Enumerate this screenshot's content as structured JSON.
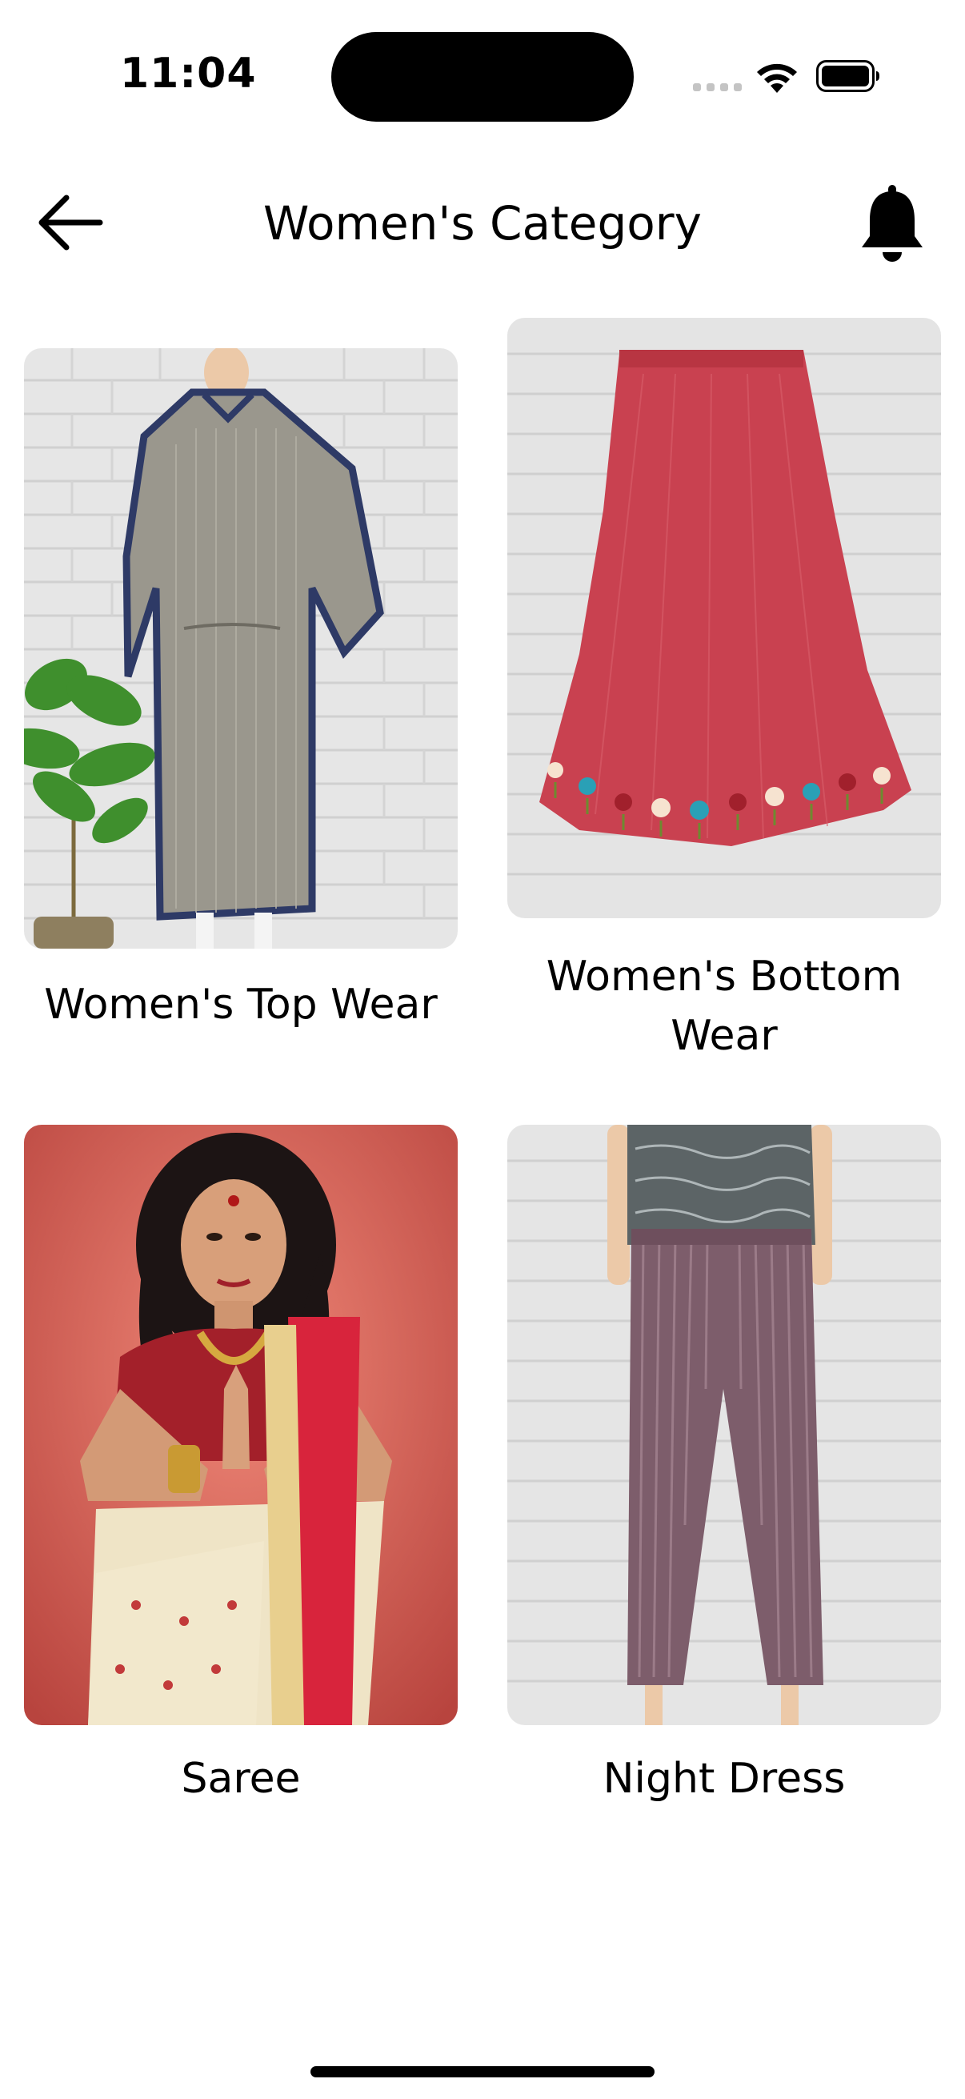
{
  "status_bar": {
    "time": "11:04",
    "icons": [
      "signal-icon",
      "wifi-icon",
      "battery-icon"
    ]
  },
  "nav": {
    "title": "Women's Category",
    "back_icon": "arrow-left-icon",
    "notification_icon": "bell-icon"
  },
  "categories": [
    {
      "label": "Women's Top Wear",
      "image": "kaftan-top-wear-photo"
    },
    {
      "label": "Women's Bottom Wear",
      "image": "red-embroidered-skirt-photo"
    },
    {
      "label": "Saree",
      "image": "woman-in-saree-photo"
    },
    {
      "label": "Night Dress",
      "image": "striped-pants-night-dress-photo"
    }
  ],
  "colors": {
    "background": "#ffffff",
    "text": "#000000",
    "skirt_red": "#c94150",
    "brick_wall": "#e4e4e4",
    "saree_bg": "#e06e66"
  }
}
